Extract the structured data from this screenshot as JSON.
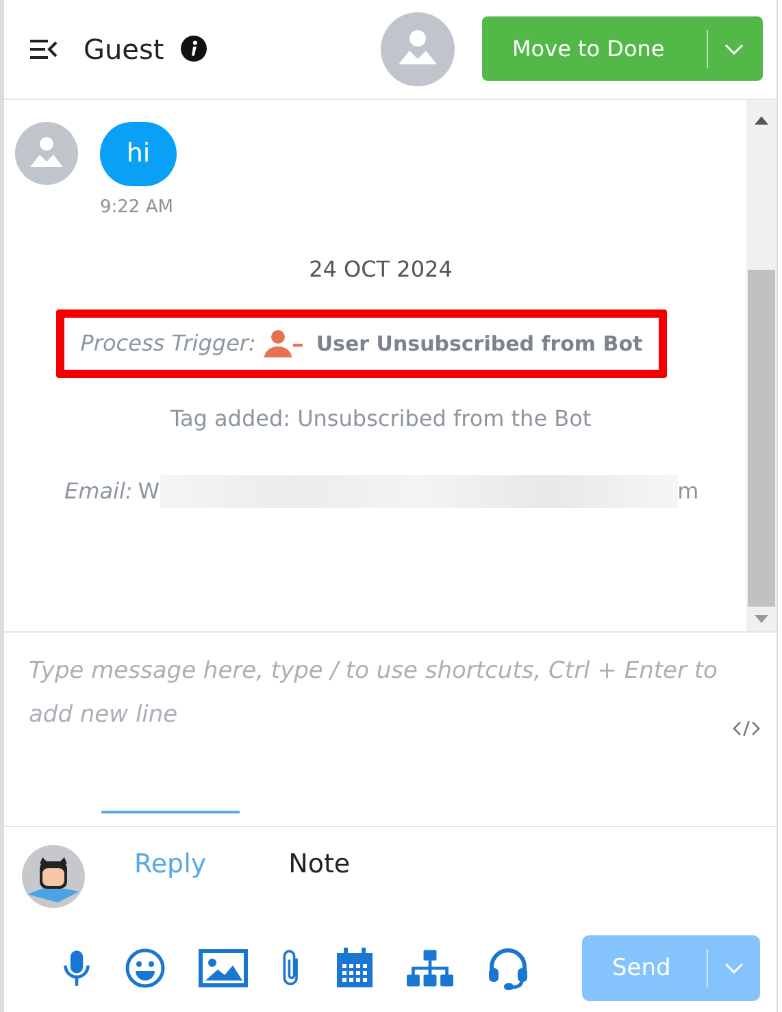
{
  "header": {
    "title": "Guest",
    "primary_button": "Move to Done"
  },
  "messages": [
    {
      "text": "hi",
      "time": "9:22 AM"
    }
  ],
  "events": [
    {
      "kind": "date",
      "text": "24 OCT 2024"
    },
    {
      "kind": "trigger",
      "label": "Process Trigger:",
      "text": "User Unsubscribed from Bot",
      "highlighted": true
    },
    {
      "kind": "tag",
      "text": "Tag added: Unsubscribed from the Bot"
    },
    {
      "kind": "email",
      "label": "Email:",
      "value_start": "W",
      "value_end": "m"
    }
  ],
  "composer": {
    "placeholder": "Type message here, type / to use shortcuts, Ctrl + Enter to add new line"
  },
  "tabs": [
    {
      "label": "Reply",
      "selected": true
    },
    {
      "label": "Note",
      "selected": false
    }
  ],
  "send_button": {
    "label": "Send",
    "disabled": true
  }
}
